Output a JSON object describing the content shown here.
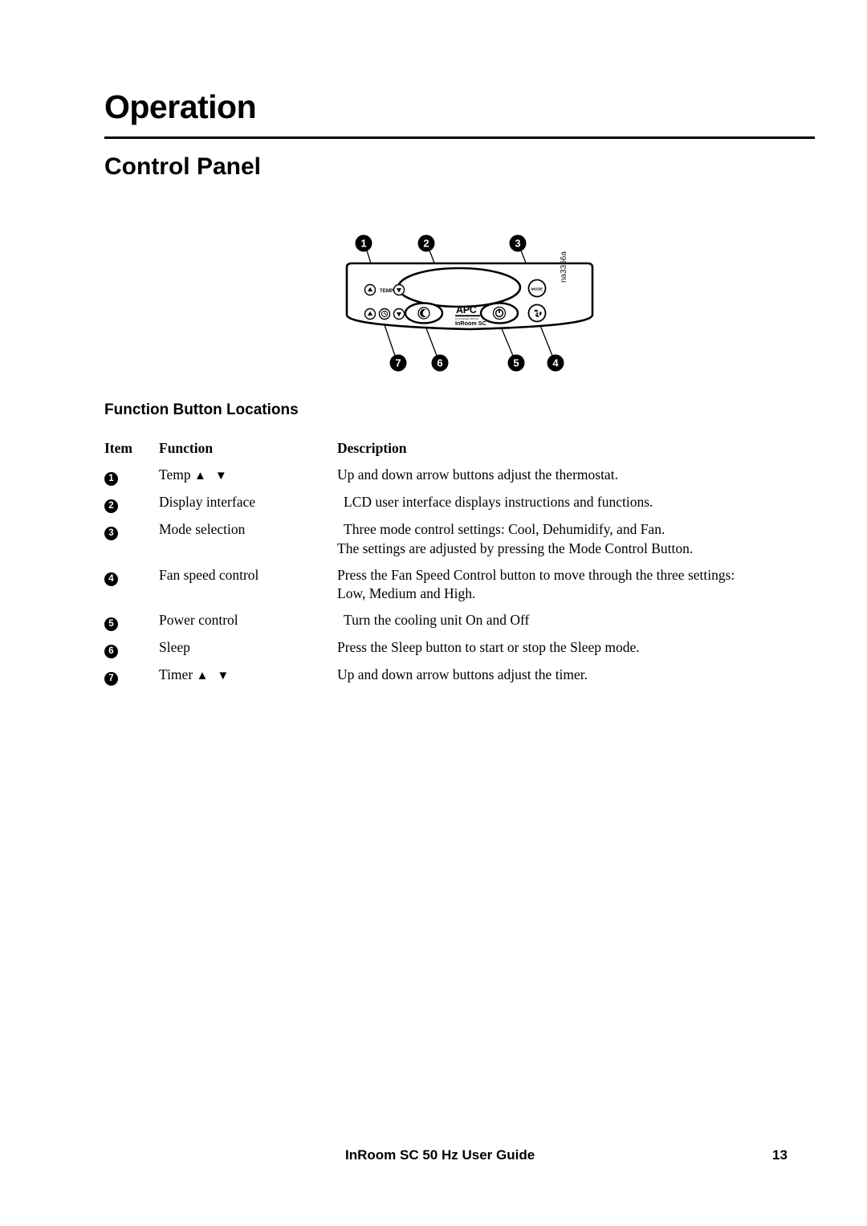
{
  "document": {
    "chapter_title": "Operation",
    "section_title": "Control Panel",
    "subsection_title": "Function Button Locations"
  },
  "figure": {
    "caption_code": "na3366a",
    "panel_labels": {
      "temp": "TEMP",
      "mode": "MODE",
      "brand": "APC",
      "brand_tagline": "by Schneider Electric",
      "product": "InRoom SC"
    },
    "callouts": [
      {
        "number": "1",
        "target": "temp-arrow-buttons"
      },
      {
        "number": "2",
        "target": "display-interface"
      },
      {
        "number": "3",
        "target": "mode-selection-button"
      },
      {
        "number": "4",
        "target": "fan-speed-control-button"
      },
      {
        "number": "5",
        "target": "power-control-button"
      },
      {
        "number": "6",
        "target": "sleep-button"
      },
      {
        "number": "7",
        "target": "timer-arrow-buttons"
      }
    ]
  },
  "table": {
    "headers": {
      "item": "Item",
      "function": "Function",
      "description": "Description"
    },
    "rows": [
      {
        "item": "1",
        "function": "Temp",
        "has_arrows": true,
        "description_lines": [
          "Up and down arrow buttons adjust the thermostat."
        ],
        "indent": false
      },
      {
        "item": "2",
        "function": "Display interface",
        "has_arrows": false,
        "description_lines": [
          "LCD user interface displays instructions and functions."
        ],
        "indent": true
      },
      {
        "item": "3",
        "function": "Mode selection",
        "has_arrows": false,
        "description_lines": [
          "Three mode control settings: Cool, Dehumidify, and Fan.",
          "The settings are adjusted by pressing the Mode Control Button."
        ],
        "indent": true
      },
      {
        "item": "4",
        "function": "Fan speed control",
        "has_arrows": false,
        "description_lines": [
          "Press the Fan Speed Control button to move through the three settings:",
          "Low, Medium and High."
        ],
        "indent": false
      },
      {
        "item": "5",
        "function": "Power control",
        "has_arrows": false,
        "description_lines": [
          "Turn the cooling unit On and Off"
        ],
        "indent": true
      },
      {
        "item": "6",
        "function": "Sleep",
        "has_arrows": false,
        "description_lines": [
          "Press the Sleep button to start or stop the Sleep mode."
        ],
        "indent": false
      },
      {
        "item": "7",
        "function": "Timer",
        "has_arrows": true,
        "description_lines": [
          "Up and down arrow buttons adjust the timer."
        ],
        "indent": false
      }
    ]
  },
  "footer": {
    "guide_title": "InRoom SC 50 Hz User Guide",
    "page_number": "13"
  },
  "glyphs": {
    "arrow_up": "▲",
    "arrow_down": "▼"
  }
}
